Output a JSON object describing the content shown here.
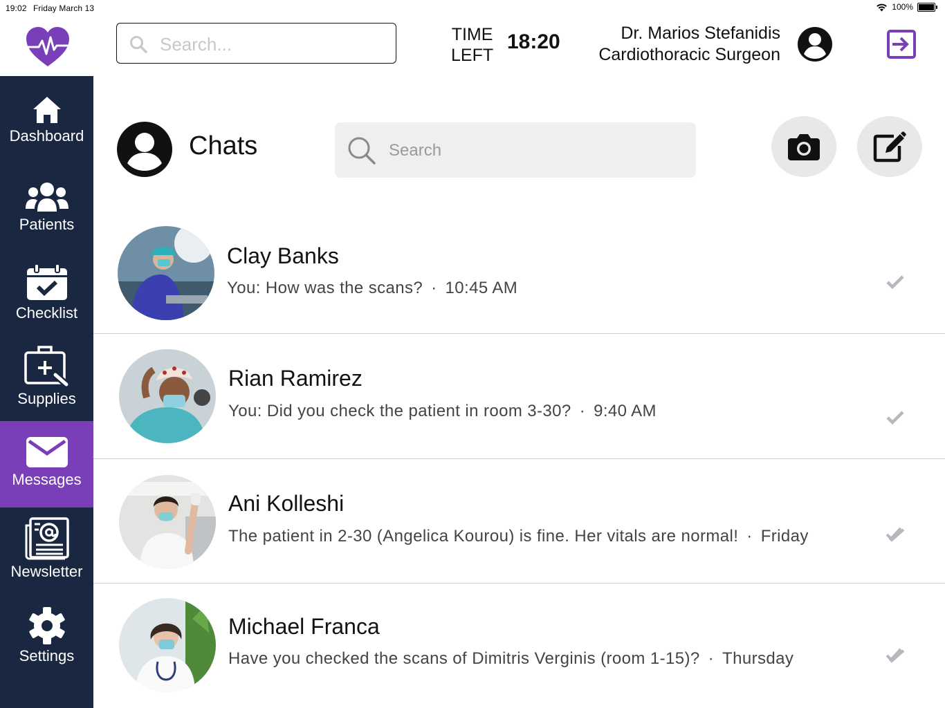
{
  "status_bar": {
    "time": "19:02",
    "date": "Friday March 13",
    "battery": "100%"
  },
  "header": {
    "search_placeholder": "Search...",
    "time_left_label_1": "TIME",
    "time_left_label_2": "LEFT",
    "time_left_value": "18:20",
    "doctor_name": "Dr. Marios Stefanidis",
    "doctor_role": "Cardiothoracic Surgeon"
  },
  "sidebar": {
    "items": [
      {
        "label": "Dashboard",
        "icon": "home-icon",
        "active": false
      },
      {
        "label": "Patients",
        "icon": "users-icon",
        "active": false
      },
      {
        "label": "Checklist",
        "icon": "calendar-check-icon",
        "active": false
      },
      {
        "label": "Supplies",
        "icon": "medical-bag-icon",
        "active": false
      },
      {
        "label": "Messages",
        "icon": "envelope-icon",
        "active": true
      },
      {
        "label": "Newsletter",
        "icon": "newsletter-icon",
        "active": false
      },
      {
        "label": "Settings",
        "icon": "gear-icon",
        "active": false
      }
    ]
  },
  "chats": {
    "title": "Chats",
    "search_placeholder": "Search",
    "conversations": [
      {
        "name": "Clay Banks",
        "message": "You: How was the scans?",
        "time": "10:45 AM",
        "status": "sent"
      },
      {
        "name": "Rian Ramirez",
        "message": "You: Did you check the patient in room 3-30?",
        "time": "9:40 AM",
        "status": "sent"
      },
      {
        "name": "Ani Kolleshi",
        "message": "The patient in 2-30 (Angelica Kourou) is fine. Her vitals are normal!",
        "time": "Friday",
        "status": "read"
      },
      {
        "name": "Michael Franca",
        "message": "Have you checked the scans of Dimitris Verginis (room 1-15)?",
        "time": "Thursday",
        "status": "read"
      }
    ]
  },
  "colors": {
    "sidebar_bg": "#1a2740",
    "accent": "#7a3fb8",
    "check": "#b5b8be"
  }
}
